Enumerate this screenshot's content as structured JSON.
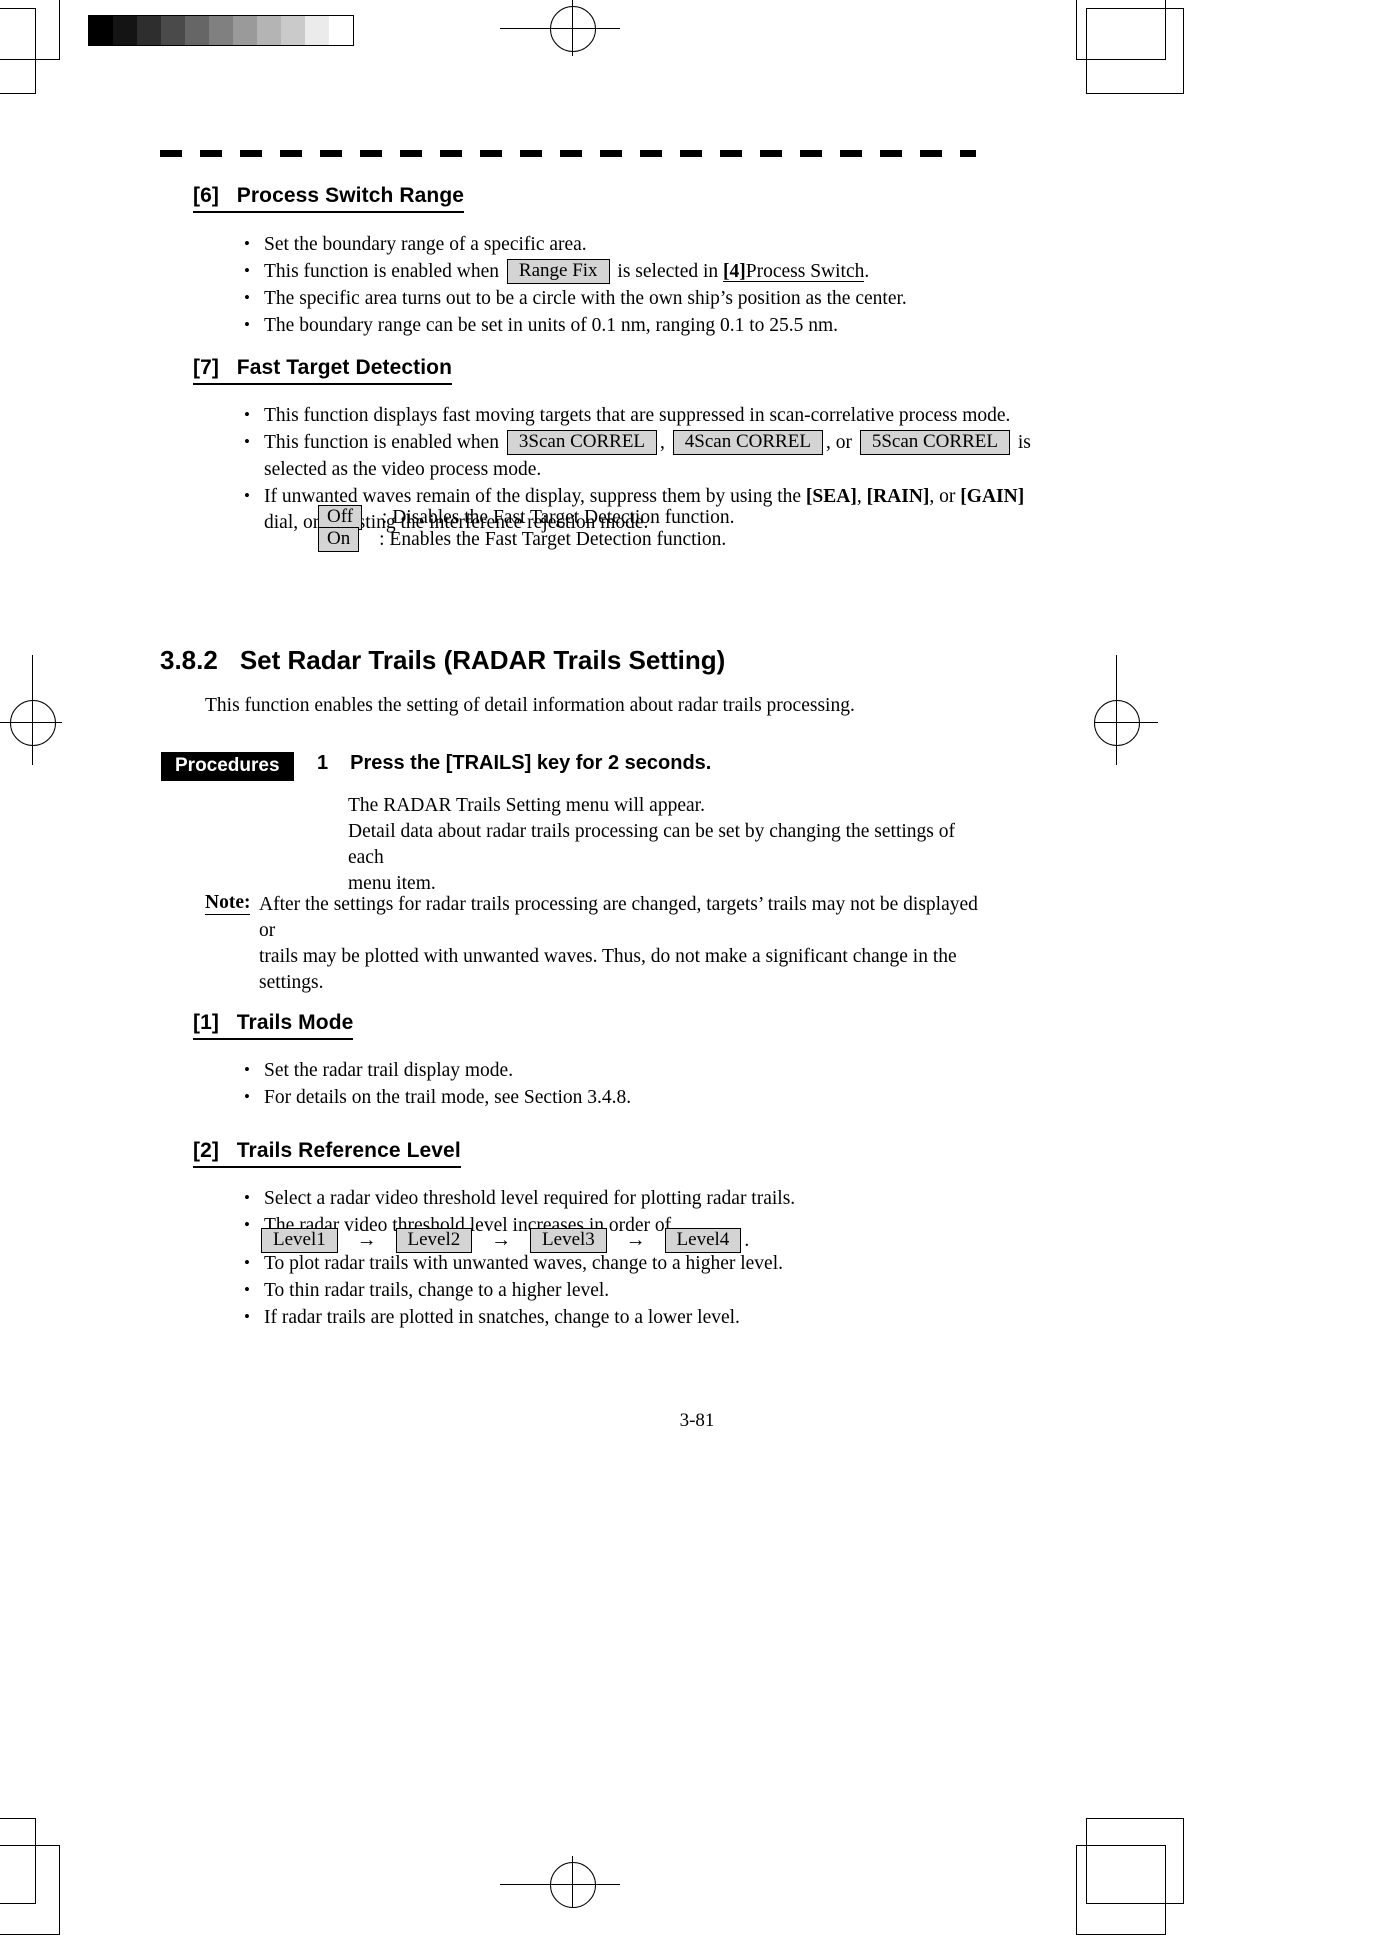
{
  "document": {
    "page_number": "3-81",
    "grayscale_bar": [
      "#000000",
      "#141414",
      "#2e2e2e",
      "#4a4a4a",
      "#666666",
      "#808080",
      "#9a9a9a",
      "#b4b4b4",
      "#cacaca",
      "#ebebeb",
      "#ffffff"
    ]
  },
  "section_6": {
    "heading_number": "[6]",
    "heading_title": "Process Switch Range",
    "bullets": [
      {
        "id": "b1",
        "parts": [
          {
            "t": "text",
            "v": "Set the boundary range of a specific area."
          }
        ]
      },
      {
        "id": "b2",
        "parts": [
          {
            "t": "text",
            "v": "This function is enabled when"
          },
          {
            "t": "key",
            "v": "Range Fix"
          },
          {
            "t": "text",
            "v": "is selected in"
          },
          {
            "t": "boldunderline",
            "v": "[4]"
          },
          {
            "t": "underline",
            "v": "Process Switch"
          },
          {
            "t": "text",
            "v": "."
          }
        ]
      },
      {
        "id": "b3",
        "parts": [
          {
            "t": "text",
            "v": "The specific area turns out to be a circle with the own ship’s position as the center."
          }
        ]
      },
      {
        "id": "b4",
        "parts": [
          {
            "t": "text",
            "v": "The boundary range can be set in units of 0.1 nm, ranging 0.1 to 25.5 nm."
          }
        ]
      }
    ]
  },
  "section_7": {
    "heading_number": "[7]",
    "heading_title": "Fast Target Detection",
    "bullet_1": "This function displays fast moving targets that are suppressed in scan-correlative process mode.",
    "bullet_2_pre": "This function is enabled when",
    "bullet_2_key1": "3Scan CORREL",
    "bullet_2_sep1": ",",
    "bullet_2_key2": "4Scan CORREL",
    "bullet_2_sep2": ", or",
    "bullet_2_key3": "5Scan CORREL",
    "bullet_2_post": "is",
    "bullet_2_line2": "selected as the video process mode.",
    "bullet_3_pre": "If unwanted waves remain of the display, suppress them by using the",
    "bullet_3_k1": "[SEA]",
    "bullet_3_c1": ",",
    "bullet_3_k2": "[RAIN]",
    "bullet_3_c2": ", or",
    "bullet_3_k3": "[GAIN]",
    "bullet_3_line2": "dial, or adjusting the interference rejection mode.",
    "options": [
      {
        "key": "Off",
        "desc": ": Disables the Fast Target Detection function."
      },
      {
        "key": "On",
        "desc": ": Enables the Fast Target Detection function."
      }
    ]
  },
  "section_382": {
    "number": "3.8.2",
    "title": "Set Radar Trails (RADAR Trails Setting)",
    "intro": "This function enables the setting of detail information about radar trails processing.",
    "procedures_label": "Procedures",
    "step_number": "1",
    "step_text": "Press the [TRAILS] key for 2 seconds.",
    "step_detail_line1": "The RADAR Trails Setting menu will appear.",
    "step_detail_line2": "Detail data about radar trails processing can be set by changing the settings of each",
    "step_detail_line3": "menu item.",
    "note_label": "Note:",
    "note_line1": "After the settings for radar trails processing are changed, targets’ trails may not be displayed or",
    "note_line2": "trails may be plotted with unwanted waves.    Thus, do not make a significant change in the",
    "note_line3": "settings."
  },
  "section_1": {
    "heading_number": "[1]",
    "heading_title": "Trails Mode",
    "bullets": [
      "Set the radar trail display mode.",
      "For details on the trail mode, see Section 3.4.8."
    ]
  },
  "section_2": {
    "heading_number": "[2]",
    "heading_title": "Trails Reference Level",
    "bullet_1": "Select a radar video threshold level required for plotting radar trails.",
    "bullet_2": "The radar video threshold level increases in order of",
    "levels": [
      "Level1",
      "Level2",
      "Level3",
      "Level4"
    ],
    "level_arrow": "→",
    "level_period": ".",
    "bullet_3": "To plot radar trails with unwanted waves, change to a higher level.",
    "bullet_4": "To thin radar trails, change to a higher level.",
    "bullet_5": "If radar trails are plotted in snatches, change to a lower level."
  }
}
